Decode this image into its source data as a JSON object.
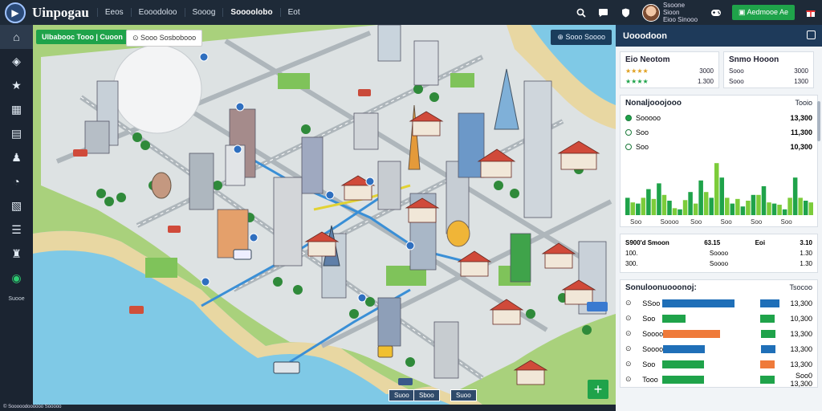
{
  "app": {
    "brand": "Uinpogau",
    "logo_icon": "play-icon"
  },
  "nav": [
    "Eeos",
    "Eooodoloo",
    "Sooog",
    "Soooolobo",
    "Eot"
  ],
  "topbar": {
    "user_name": "Ssoone Sioon",
    "user_sub": "Eioo Sinooo",
    "action_label": "Aedmooe Ae",
    "icons": [
      "search-icon",
      "chat-icon",
      "shield-icon",
      "gamepad-icon",
      "gift-icon"
    ]
  },
  "sidebar": {
    "items": [
      "home-icon",
      "globe-icon",
      "star-icon",
      "chart-icon",
      "task-icon",
      "people-icon",
      "clock-icon",
      "document-icon",
      "list-icon",
      "user-icon",
      "support-icon"
    ],
    "bottom_label": "Suooe"
  },
  "map": {
    "top_left_chip": "Ulbabooc Tooo | Cuoon",
    "search_label": "Sooo Sosbobooo",
    "top_right_chip": "Sooo Soooo",
    "bottom_chip_1": "Suoo",
    "bottom_chip_2": "Sboo",
    "bottom_chip_3": "Suoo",
    "add_label": "+",
    "footer": "© Sooooodoooooo Sooooo"
  },
  "panel": {
    "title": "Uooodoon",
    "card1": {
      "title": "Eio Neotom",
      "rows": [
        {
          "label": "★★★★",
          "value": "3000"
        },
        {
          "label": "★★★★",
          "value": "1.300"
        }
      ]
    },
    "card2": {
      "title": "Snmo Hooon",
      "rows": [
        {
          "label": "Sooo",
          "value": "3000"
        },
        {
          "label": "Sooo",
          "value": "1300"
        }
      ]
    },
    "chart_section": {
      "title": "Nonaljooojooo",
      "right": "Tooio"
    },
    "legend": [
      {
        "label": "Sooooo",
        "value": "13,300"
      },
      {
        "label": "Soo",
        "value": "11,300"
      },
      {
        "label": "Soo",
        "value": "10,300"
      }
    ],
    "stats_row": {
      "a_label": "S900'd Smoon",
      "b_value": "63.15",
      "c_label": "Eoi",
      "c_value": "3.10"
    },
    "stats_sub": [
      {
        "l1": "100.",
        "v1": "Soooo",
        "l2": "1.30"
      },
      {
        "l1": "300.",
        "v1": "Soooo",
        "l2": "1.30"
      }
    ],
    "bars_section": {
      "title": "Sonuloonuooonoj:",
      "right": "Tsocoo"
    },
    "bars": [
      {
        "label": "SSoo",
        "value": "13,300"
      },
      {
        "label": "Soo",
        "value": "10,300"
      },
      {
        "label": "Soooo",
        "value": "13,300"
      },
      {
        "label": "Soooo",
        "value": "13,300"
      },
      {
        "label": "Soo",
        "value": "13,300"
      },
      {
        "label": "Tooo",
        "value": "Soo0 13,300"
      }
    ]
  },
  "chart_data": {
    "type": "bar",
    "title": "Nonaljooojooo",
    "categories": [
      "Soo",
      "Soooo",
      "Soo",
      "Soo",
      "Soo",
      "Soo"
    ],
    "series": [
      {
        "name": "Sooooo",
        "values": [
          30,
          20,
          45,
          55,
          25,
          10,
          40,
          60,
          30,
          65,
          20,
          15,
          35,
          50,
          20,
          10,
          65,
          25
        ]
      },
      {
        "name": "Soo",
        "values": [
          22,
          30,
          28,
          35,
          12,
          26,
          20,
          40,
          90,
          30,
          28,
          25,
          35,
          22,
          18,
          30,
          30,
          22
        ]
      }
    ],
    "ylim": [
      0,
      100
    ],
    "colors": {
      "series1": "#1fa34a",
      "series2": "#7ccc3a"
    }
  },
  "hbars_data": {
    "values_left": [
      0.95,
      0.3,
      0.75,
      0.55,
      0.55,
      0.55
    ],
    "values_right": [
      0.8,
      0.6,
      0.6,
      0.6,
      0.6,
      0.6
    ],
    "colors_left": [
      "#1f6fb8",
      "#1fa34a",
      "#ef7a3a",
      "#1f6fb8",
      "#1fa34a",
      "#1fa34a"
    ],
    "colors_right": [
      "#1f6fb8",
      "#1fa34a",
      "#1fa34a",
      "#1f6fb8",
      "#ef7a3a",
      "#1fa34a"
    ]
  }
}
